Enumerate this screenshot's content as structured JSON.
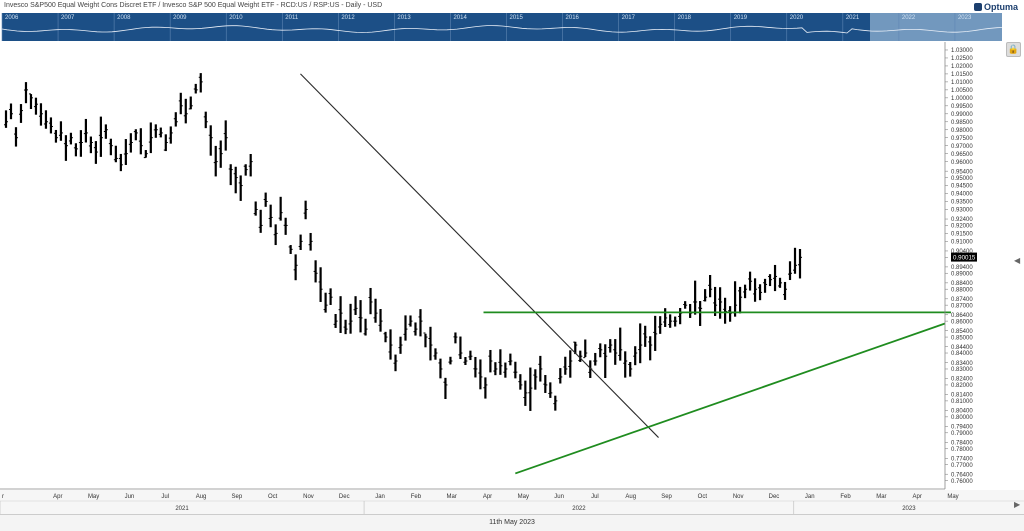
{
  "window": {
    "title": "Invesco S&P500 Equal Weight Cons Discret ETF / Invesco S&P 500 Equal Weight ETF - RCD:US / RSP:US - Daily - USD",
    "brand": "Optuma",
    "date_footer": "11th May 2023"
  },
  "navigator": {
    "years": [
      "2006",
      "2007",
      "2008",
      "2009",
      "2010",
      "2011",
      "2012",
      "2013",
      "2014",
      "2015",
      "2016",
      "2017",
      "2018",
      "2019",
      "2020",
      "2021",
      "2022",
      "2023"
    ],
    "background_color": "#1c4f86",
    "highlight_color": "#8fb0d0"
  },
  "colors": {
    "price": "#000000",
    "trendline": "#2a2a2a",
    "support": "#1f8c1f",
    "label_bg": "#000000"
  },
  "icons": {
    "lock": "lock-icon",
    "right_arrow": "chevron-right-icon",
    "left_arrow": "chevron-left-icon"
  },
  "chart_data": {
    "type": "line",
    "style": "ohlc-bars",
    "title": "Invesco S&P500 Equal Weight Cons Discret ETF / Invesco S&P 500 Equal Weight ETF - RCD:US / RSP:US - Daily - USD",
    "last_value_label": "0.90015",
    "xlabel": "",
    "ylabel": "",
    "ylim": [
      0.756,
      1.035
    ],
    "grid": false,
    "y_ticks": [
      1.03,
      1.025,
      1.02,
      1.015,
      1.01,
      1.005,
      1.0,
      0.995,
      0.99,
      0.985,
      0.98,
      0.975,
      0.97,
      0.965,
      0.96,
      0.954,
      0.95,
      0.945,
      0.94,
      0.935,
      0.93,
      0.924,
      0.92,
      0.915,
      0.91,
      0.904,
      0.9,
      0.894,
      0.89,
      0.884,
      0.88,
      0.874,
      0.87,
      0.864,
      0.86,
      0.854,
      0.85,
      0.844,
      0.84,
      0.834,
      0.83,
      0.824,
      0.82,
      0.814,
      0.81,
      0.804,
      0.8,
      0.794,
      0.79,
      0.784,
      0.78,
      0.774,
      0.77,
      0.764,
      0.76
    ],
    "y_tick_labels": [
      "1.03000",
      "1.02500",
      "1.02000",
      "1.01500",
      "1.01000",
      "1.00500",
      "1.00000",
      "0.99500",
      "0.99000",
      "0.98500",
      "0.98000",
      "0.97500",
      "0.97000",
      "0.96500",
      "0.96000",
      "0.95400",
      "0.95000",
      "0.94500",
      "0.94000",
      "0.93500",
      "0.93000",
      "0.92400",
      "0.92000",
      "0.91500",
      "0.91000",
      "0.90400",
      "0.90000",
      "0.89400",
      "0.89000",
      "0.88400",
      "0.88000",
      "0.87400",
      "0.87000",
      "0.86400",
      "0.86000",
      "0.85400",
      "0.85000",
      "0.84400",
      "0.84000",
      "0.83400",
      "0.83000",
      "0.82400",
      "0.82000",
      "0.81400",
      "0.81000",
      "0.80400",
      "0.80000",
      "0.79400",
      "0.79000",
      "0.78400",
      "0.78000",
      "0.77400",
      "0.77000",
      "0.76400",
      "0.76000"
    ],
    "x_months": [
      "r",
      "Apr",
      "May",
      "Jun",
      "Jul",
      "Aug",
      "Sep",
      "Oct",
      "Nov",
      "Dec",
      "Jan",
      "Feb",
      "Mar",
      "Apr",
      "May",
      "Jun",
      "Jul",
      "Aug",
      "Sep",
      "Oct",
      "Nov",
      "Dec",
      "Jan",
      "Feb",
      "Mar",
      "Apr",
      "May"
    ],
    "x_years": [
      "2021",
      "2022",
      "2023"
    ],
    "x_period": [
      "2021-03",
      "2023-05"
    ],
    "series": [
      {
        "values": [
          [
            0.985,
            0.99,
            0.975,
            0.992,
            1.005,
            1.0,
            0.996,
            0.99,
            0.985,
            0.982,
            0.975,
            0.978,
            0.97,
            0.975,
            0.968,
            0.972,
            0.978,
            0.972,
            0.966,
            0.975,
            0.98,
            0.97,
            0.962,
            0.958,
            0.965,
            0.972,
            0.978,
            0.97,
            0.965,
            0.975,
            0.98,
            0.978,
            0.972,
            0.978,
            0.985,
            0.995,
            0.99,
            0.995,
            1.005,
            1.01,
            0.985,
            0.975,
            0.96,
            0.965,
            0.975,
            0.955,
            0.95,
            0.945,
            0.955,
            0.96
          ],
          [
            0.93,
            0.92,
            0.935,
            0.925,
            0.915,
            0.928,
            0.92,
            0.905,
            0.895,
            0.91,
            0.93,
            0.91,
            0.89,
            0.88,
            0.87,
            0.875,
            0.86,
            0.865,
            0.855,
            0.86,
            0.868,
            0.862,
            0.855,
            0.872,
            0.865,
            0.86,
            0.85,
            0.845,
            0.835,
            0.845,
            0.855,
            0.86,
            0.855,
            0.86,
            0.85,
            0.845,
            0.84,
            0.83,
            0.82,
            0.835,
            0.85,
            0.84,
            0.835,
            0.838,
            0.83,
            0.825,
            0.82,
            0.835,
            0.83,
            0.832
          ],
          [
            0.83,
            0.835,
            0.828,
            0.82,
            0.815,
            0.818,
            0.825,
            0.83,
            0.82,
            0.815,
            0.81,
            0.825,
            0.83,
            0.835,
            0.845,
            0.838,
            0.84,
            0.83,
            0.835,
            0.842,
            0.838,
            0.845,
            0.84,
            0.842,
            0.835,
            0.83,
            0.84,
            0.845,
            0.85,
            0.845,
            0.852,
            0.858,
            0.862,
            0.86,
            0.86,
            0.865,
            0.87,
            0.865,
            0.872,
            0.868,
            0.875,
            0.88,
            0.87,
            0.872,
            0.866,
            0.865,
            0.87,
            0.875,
            0.88,
            0.885
          ],
          [
            0.88,
            0.878,
            0.883,
            0.886,
            0.888,
            0.884,
            0.88,
            0.89,
            0.895,
            0.9
          ]
        ]
      }
    ],
    "annotations": [
      {
        "type": "trendline",
        "from": [
          "2021-11",
          1.015
        ],
        "to": [
          "2022-09",
          0.787
        ]
      },
      {
        "type": "horizontal",
        "value": 0.8655,
        "from": "2022-04",
        "to": "2023-05"
      },
      {
        "type": "trendline",
        "from": [
          "2022-05",
          0.7645
        ],
        "to": [
          "2023-05",
          0.8585
        ]
      }
    ]
  }
}
